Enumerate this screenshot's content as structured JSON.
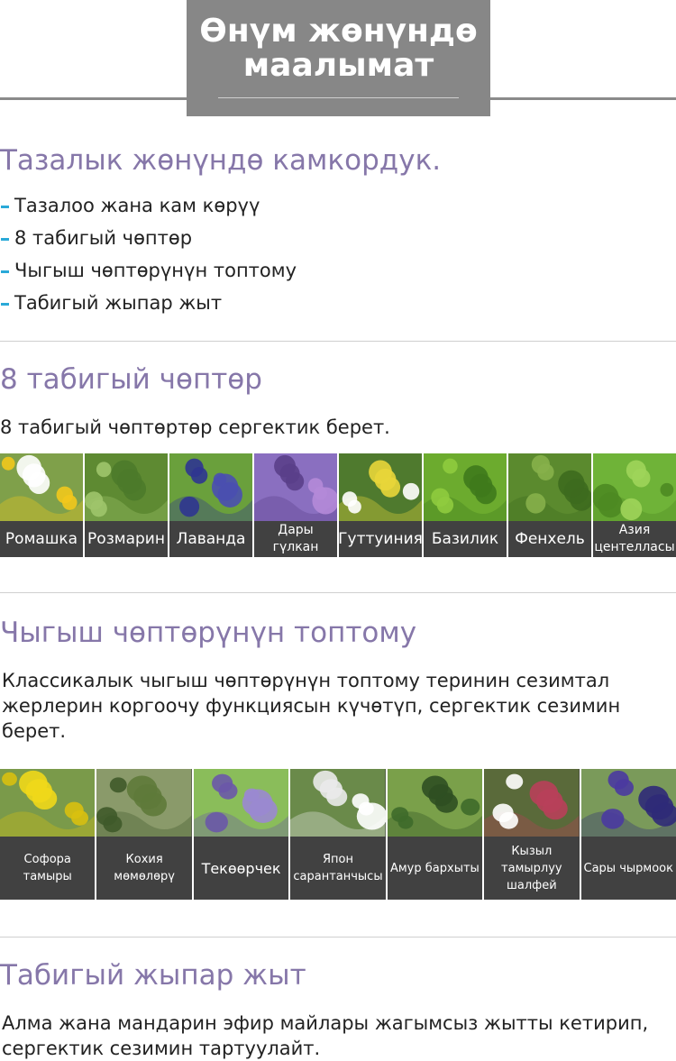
{
  "header": {
    "title": "Өнүм жөнүндө маалымат"
  },
  "care": {
    "title": "Тазалык жөнүндө камкордук.",
    "bullets": [
      "Тазалоо жана кам көрүү",
      "8 табигый чөптөр",
      "Чыгыш чөптөрүнүн топтому",
      "Табигый жыпар жыт"
    ]
  },
  "herbs": {
    "title": "8 табигый чөптөр",
    "description": "8 табигый чөптөртөр сергектик берет.",
    "items": [
      {
        "label": "Ромашка",
        "icon": "chamomile-photo"
      },
      {
        "label": "Розмарин",
        "icon": "rosemary-photo"
      },
      {
        "label": "Лаванда",
        "icon": "lavender-photo"
      },
      {
        "label": "Дары гүлкан",
        "icon": "mallow-photo"
      },
      {
        "label": "Гуттуиния",
        "icon": "houttuynia-photo"
      },
      {
        "label": "Базилик",
        "icon": "basil-photo"
      },
      {
        "label": "Фенхель",
        "icon": "fennel-photo"
      },
      {
        "label": "Азия центелласы",
        "icon": "centella-photo"
      }
    ]
  },
  "eastern": {
    "title": "Чыгыш чөптөрүнүн топтому",
    "description": "Классикалык чыгыш чөптөрүнүн топтому теринин сезимтал жерлерин коргоочу функциясын күчөтүп, сергектик сезимин берет.",
    "items": [
      {
        "label": "Софора тамыры",
        "icon": "sophora-photo"
      },
      {
        "label": "Кохия мөмөлөрү",
        "icon": "kochia-photo"
      },
      {
        "label": "Текөөрчек",
        "icon": "skullcap-photo"
      },
      {
        "label": "Япон сарантанчысы",
        "icon": "japanese-honeysuckle-photo"
      },
      {
        "label": "Амур бархыты",
        "icon": "amur-cork-photo"
      },
      {
        "label": "Кызыл тамырлуу шалфей",
        "icon": "red-sage-photo"
      },
      {
        "label": "Сары чырмоок",
        "icon": "bugle-photo"
      }
    ]
  },
  "fragrance": {
    "title": "Табигый жыпар жыт",
    "description": "Алма жана мандарин эфир майлары жагымсыз жытты кетирип, сергектик сезимин тартуулайт."
  },
  "colors": {
    "accent": "#8677a9",
    "bullet": "#2aa9d8",
    "header_box": "#878787",
    "caption_bg": "#414141"
  }
}
